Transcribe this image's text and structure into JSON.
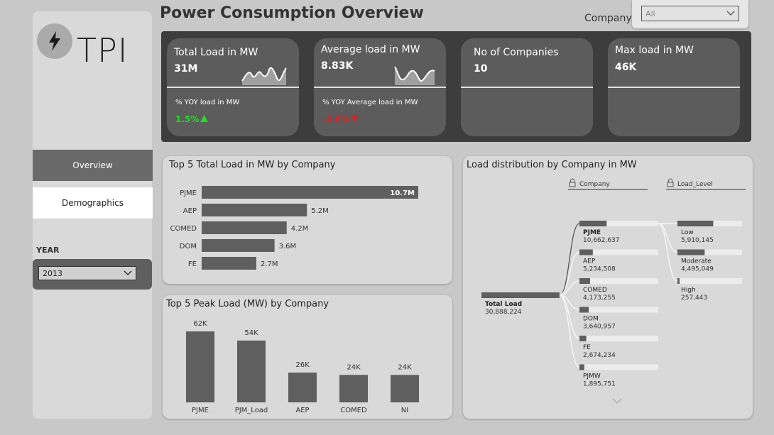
{
  "sidebar": {
    "logo_text": "TPI",
    "nav": {
      "overview": "Overview",
      "demographics": "Demographics"
    },
    "year_label": "YEAR",
    "year_value": "2013"
  },
  "header": {
    "title": "Power Consumption Overview",
    "company_label": "Company",
    "company_value": "All"
  },
  "kpis": [
    {
      "title": "Total Load in MW",
      "value": "31M",
      "sub": "% YOY load in MW",
      "yoy": "1.5%",
      "yoy_dir": "up"
    },
    {
      "title": "Average load in MW",
      "value": "8.83K",
      "sub": "% YOY Average load in MW",
      "yoy": "-4.6%",
      "yoy_dir": "down"
    },
    {
      "title": "No of Companies",
      "value": "10"
    },
    {
      "title": "Max load in MW",
      "value": "46K"
    }
  ],
  "colors": {
    "bar": "#5f5f5f",
    "up": "#22dd22",
    "down": "#e02020"
  },
  "chart_data": [
    {
      "type": "bar",
      "orientation": "horizontal",
      "title": "Top 5 Total Load in MW by Company",
      "categories": [
        "PJME",
        "AEP",
        "COMED",
        "DOM",
        "FE"
      ],
      "values": [
        10.7,
        5.2,
        4.2,
        3.6,
        2.7
      ],
      "value_labels": [
        "10.7M",
        "5.2M",
        "4.2M",
        "3.6M",
        "2.7M"
      ]
    },
    {
      "type": "bar",
      "orientation": "vertical",
      "title": "Top 5 Peak Load (MW) by Company",
      "categories": [
        "PJME",
        "PJM_Load",
        "AEP",
        "COMED",
        "NI"
      ],
      "values": [
        62,
        54,
        26,
        24,
        24
      ],
      "value_labels": [
        "62K",
        "54K",
        "26K",
        "24K",
        "24K"
      ]
    },
    {
      "type": "decomposition_tree",
      "title": "Load distribution by Company in MW",
      "level_headers": [
        "Company",
        "Load_Level"
      ],
      "root": {
        "label": "Total Load",
        "value": "30,888,224",
        "raw": 30888224
      },
      "companies": [
        {
          "label": "PJME",
          "value": "10,662,637",
          "raw": 10662637
        },
        {
          "label": "AEP",
          "value": "5,234,508",
          "raw": 5234508
        },
        {
          "label": "COMED",
          "value": "4,173,255",
          "raw": 4173255
        },
        {
          "label": "DOM",
          "value": "3,640,957",
          "raw": 3640957
        },
        {
          "label": "FE",
          "value": "2,674,234",
          "raw": 2674234
        },
        {
          "label": "PJMW",
          "value": "1,895,751",
          "raw": 1895751
        }
      ],
      "levels": [
        {
          "label": "Low",
          "value": "5,910,145",
          "raw": 5910145
        },
        {
          "label": "Moderate",
          "value": "4,495,049",
          "raw": 4495049
        },
        {
          "label": "High",
          "value": "257,443",
          "raw": 257443
        }
      ]
    }
  ]
}
